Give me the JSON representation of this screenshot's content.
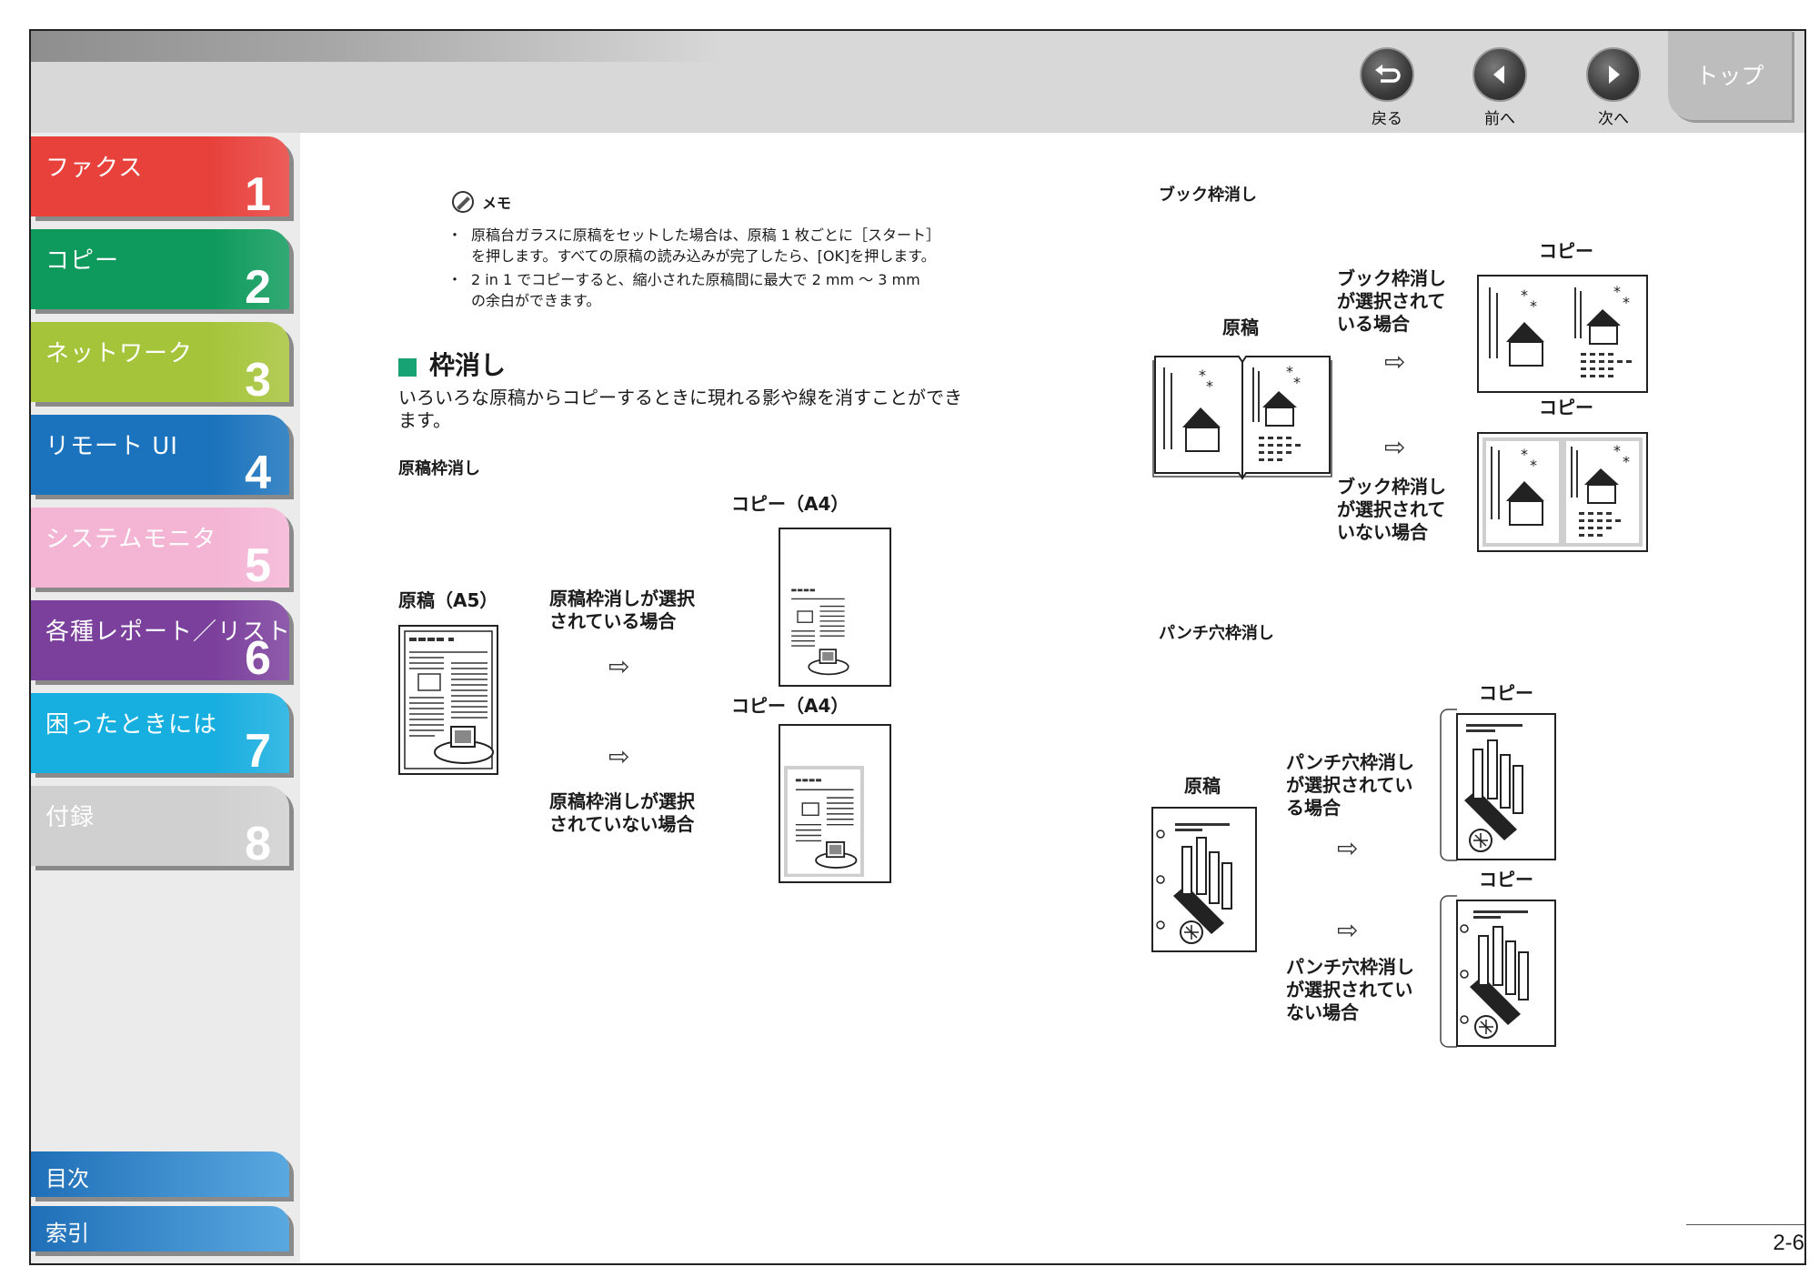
{
  "nav": {
    "back": "戻る",
    "prev": "前へ",
    "next": "次へ",
    "top": "トップ"
  },
  "sidebar": {
    "tabs": [
      {
        "label": "ファクス",
        "num": "1",
        "color": "#e8413c"
      },
      {
        "label": "コピー",
        "num": "2",
        "color": "#0e9a5c"
      },
      {
        "label": "ネットワーク",
        "num": "3",
        "color": "#a6c43a"
      },
      {
        "label": "リモート UI",
        "num": "4",
        "color": "#1a73bc"
      },
      {
        "label": "システムモニタ",
        "num": "5",
        "color": "#f4b4d4"
      },
      {
        "label": "各種レポート／リスト",
        "num": "6",
        "color": "#7b3f9c"
      },
      {
        "label": "困ったときには",
        "num": "7",
        "color": "#17aee0"
      },
      {
        "label": "付録",
        "num": "8",
        "color": "#d0d0d0"
      }
    ],
    "toc": "目次",
    "index": "索引"
  },
  "memo": {
    "title": "メモ",
    "items": [
      {
        "line1": "原稿台ガラスに原稿をセットした場合は、原稿 1 枚ごとに［スタート］",
        "line2": "を押します。すべての原稿の読み込みが完了したら、[OK]を押します。"
      },
      {
        "line1": "2 in 1 でコピーすると、縮小された原稿間に最大で 2 mm 〜 3 mm",
        "line2": "の余白ができます。"
      }
    ]
  },
  "section": {
    "title": "枠消し",
    "desc1": "いろいろな原稿からコピーするときに現れる影や線を消すことができ",
    "desc2": "ます。"
  },
  "original_erase": {
    "heading": "原稿枠消し",
    "orig_label": "原稿（A5）",
    "copy_label": "コピー（A4）",
    "sel1": "原稿枠消しが選択",
    "sel2": "されている場合",
    "unsel1": "原稿枠消しが選択",
    "unsel2": "されていない場合"
  },
  "book_erase": {
    "heading": "ブック枠消し",
    "orig_label": "原稿",
    "copy_label": "コピー",
    "sel1": "ブック枠消し",
    "sel2": "が選択されて",
    "sel3": "いる場合",
    "unsel1": "ブック枠消し",
    "unsel2": "が選択されて",
    "unsel3": "いない場合"
  },
  "punch_erase": {
    "heading": "パンチ穴枠消し",
    "orig_label": "原稿",
    "copy_label": "コピー",
    "sel1": "パンチ穴枠消し",
    "sel2": "が選択されてい",
    "sel3": "る場合",
    "unsel1": "パンチ穴枠消し",
    "unsel2": "が選択されてい",
    "unsel3": "ない場合"
  },
  "arrow_glyph": "⇨",
  "page_number": "2-6"
}
